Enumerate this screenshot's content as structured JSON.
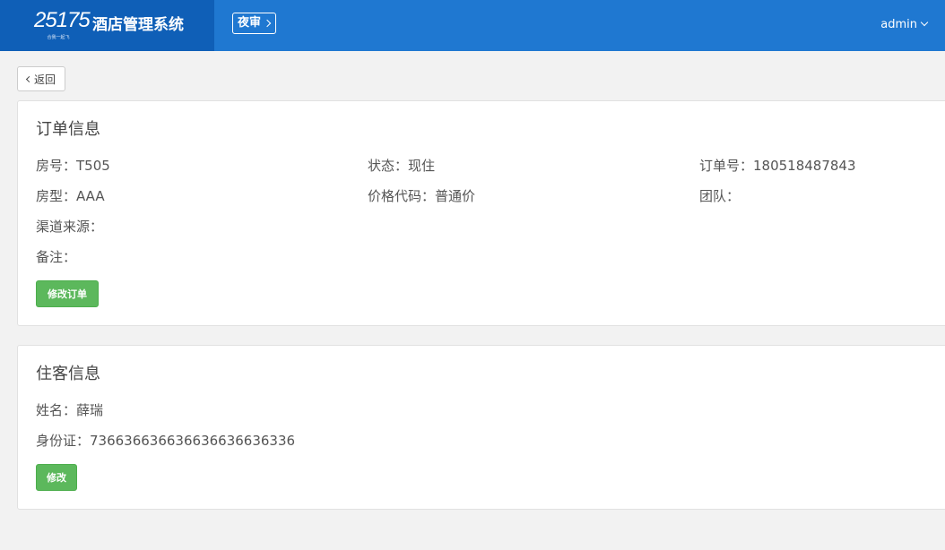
{
  "header": {
    "logo_text": "25175",
    "logo_tagline": "合我一起飞",
    "title": "酒店管理系统",
    "night_audit_label": "夜审",
    "user": "admin"
  },
  "back_label": "返回",
  "order_panel": {
    "title": "订单信息",
    "room_no": "房号：T505",
    "status": "状态：现住",
    "order_no": "订单号：180518487843",
    "room_type": "房型：AAA",
    "price_code": "价格代码：普通价",
    "group": "团队：",
    "channel": "渠道来源：",
    "remark": "备注：",
    "edit_button": "修改订单"
  },
  "guest_panel": {
    "title": "住客信息",
    "name": "姓名：薛瑞",
    "id_card": "身份证：736636636636636636636336",
    "edit_button": "修改"
  },
  "colors": {
    "header_bg": "#1f78d1",
    "brand_bg": "#0f5fb7",
    "button_green": "#5cb85c",
    "page_bg": "#f2f2f2"
  }
}
